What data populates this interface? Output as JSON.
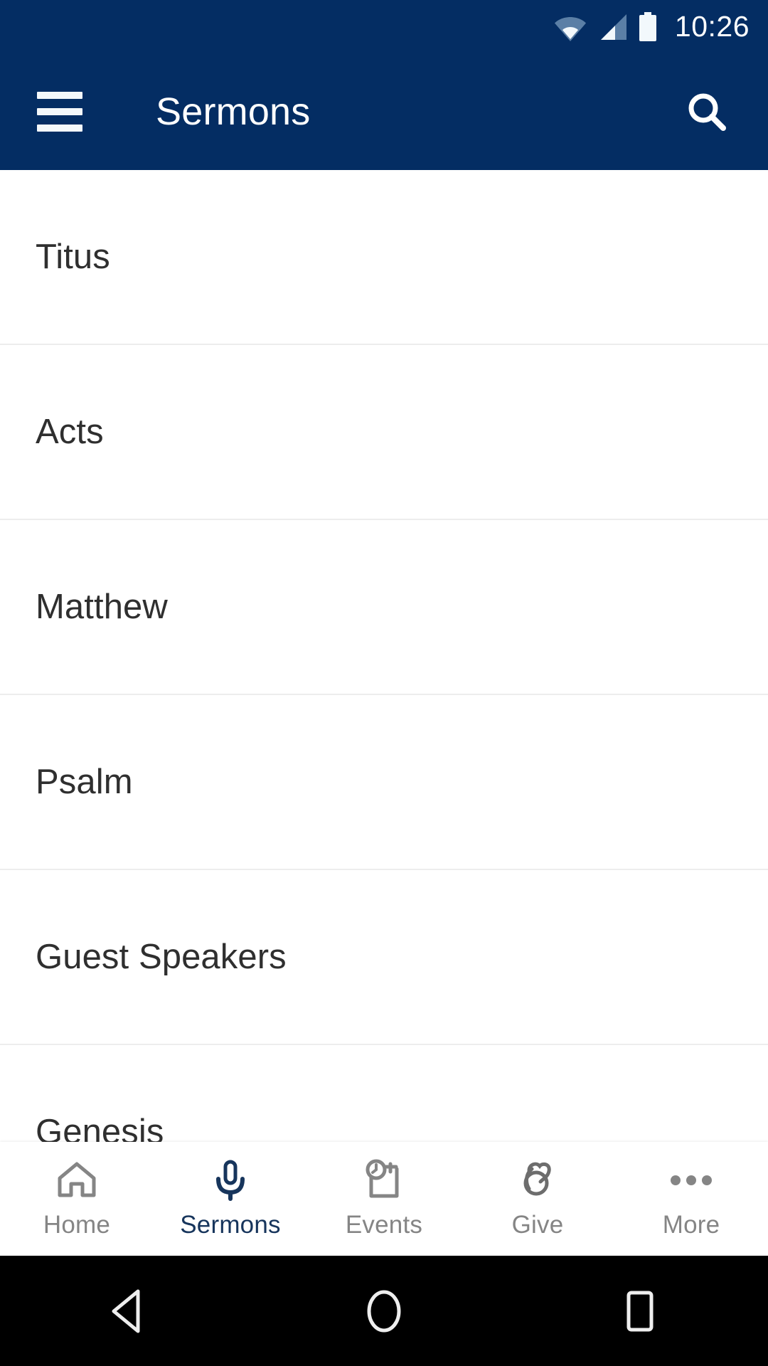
{
  "status_bar": {
    "time": "10:26",
    "icons": [
      "wifi-icon",
      "cellular-signal-icon",
      "battery-full-icon"
    ]
  },
  "app_bar": {
    "menu_icon": "hamburger-menu-icon",
    "title": "Sermons",
    "search_icon": "search-icon",
    "background_color": "#042D63",
    "text_color": "#FFFFFF"
  },
  "list": {
    "items": [
      {
        "label": "Titus"
      },
      {
        "label": "Acts"
      },
      {
        "label": "Matthew"
      },
      {
        "label": "Psalm"
      },
      {
        "label": "Guest Speakers"
      },
      {
        "label": "Genesis"
      }
    ]
  },
  "tab_bar": {
    "active_color": "#17355C",
    "inactive_color": "#858585",
    "tabs": [
      {
        "label": "Home",
        "icon": "home-icon",
        "active": false
      },
      {
        "label": "Sermons",
        "icon": "microphone-icon",
        "active": true
      },
      {
        "label": "Events",
        "icon": "calendar-clock-icon",
        "active": false
      },
      {
        "label": "Give",
        "icon": "giving-hand-icon",
        "active": false
      },
      {
        "label": "More",
        "icon": "more-dots-icon",
        "active": false
      }
    ]
  },
  "android_nav": {
    "buttons": [
      {
        "name": "back",
        "icon": "back-triangle-icon"
      },
      {
        "name": "home",
        "icon": "home-circle-icon"
      },
      {
        "name": "recents",
        "icon": "recents-square-icon"
      }
    ]
  }
}
